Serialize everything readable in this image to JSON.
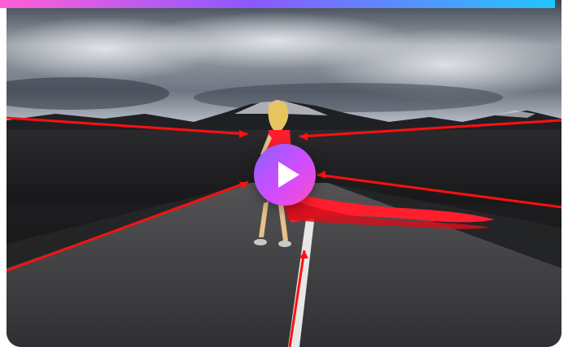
{
  "video": {
    "play_control": "play-icon",
    "gradient": [
      "#ff5fd6",
      "#8d58ff",
      "#23c6ff"
    ],
    "accent_colors": {
      "guides": "#ff1010",
      "dress": "#ff1e2d",
      "play_start": "#8a62ff",
      "play_end": "#ff4ec5"
    }
  }
}
